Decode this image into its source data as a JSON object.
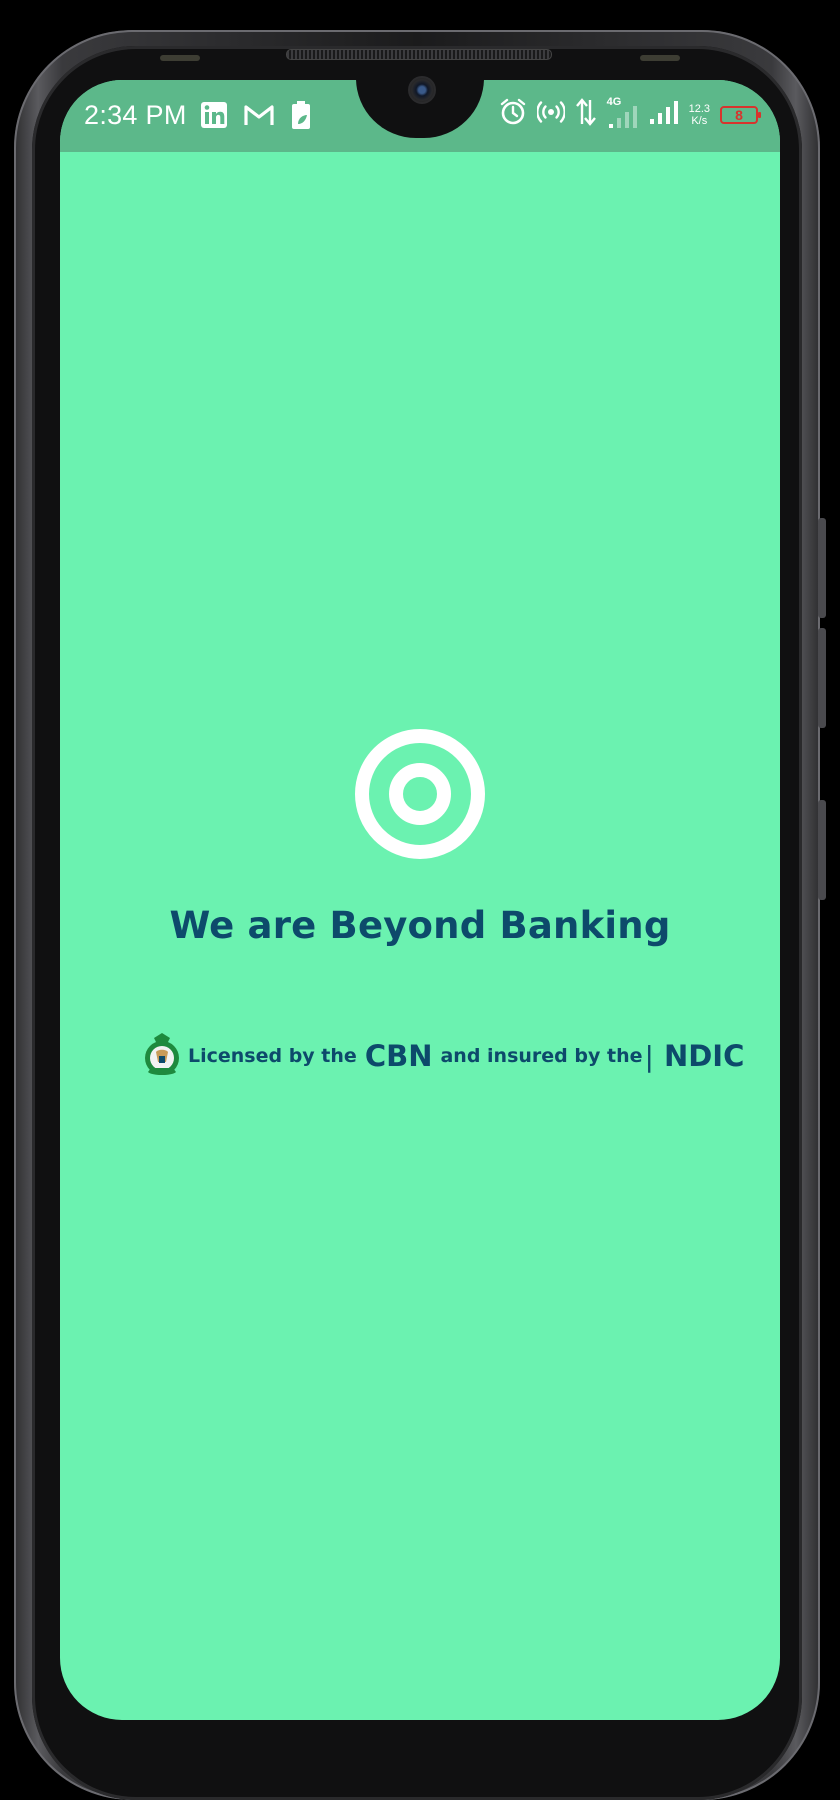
{
  "status_bar": {
    "time": "2:34 PM",
    "network_type": "4G",
    "net_speed_value": "12.3",
    "net_speed_unit": "K/s",
    "battery_level": "8",
    "left_icons": [
      "linkedin-icon",
      "gmail-icon",
      "battery-saver-icon"
    ],
    "right_icons": [
      "alarm-icon",
      "hotspot-icon",
      "data-arrows-icon",
      "signal-4g-icon",
      "signal-icon",
      "battery-icon"
    ]
  },
  "splash": {
    "logo": "target-ring-logo-icon",
    "tagline": "We are Beyond Banking",
    "license_prefix": "Licensed by the",
    "license_cbn": "CBN",
    "license_middle": "and insured by the",
    "license_sep": "|",
    "license_ndic": "NDIC",
    "seal": "cbn-seal-icon"
  },
  "colors": {
    "screen_bg": "#6bf2b0",
    "status_bar_bg": "#5cb88a",
    "text_primary": "#0d4a6b",
    "logo": "#ffffff",
    "battery_low": "#d8342d"
  }
}
